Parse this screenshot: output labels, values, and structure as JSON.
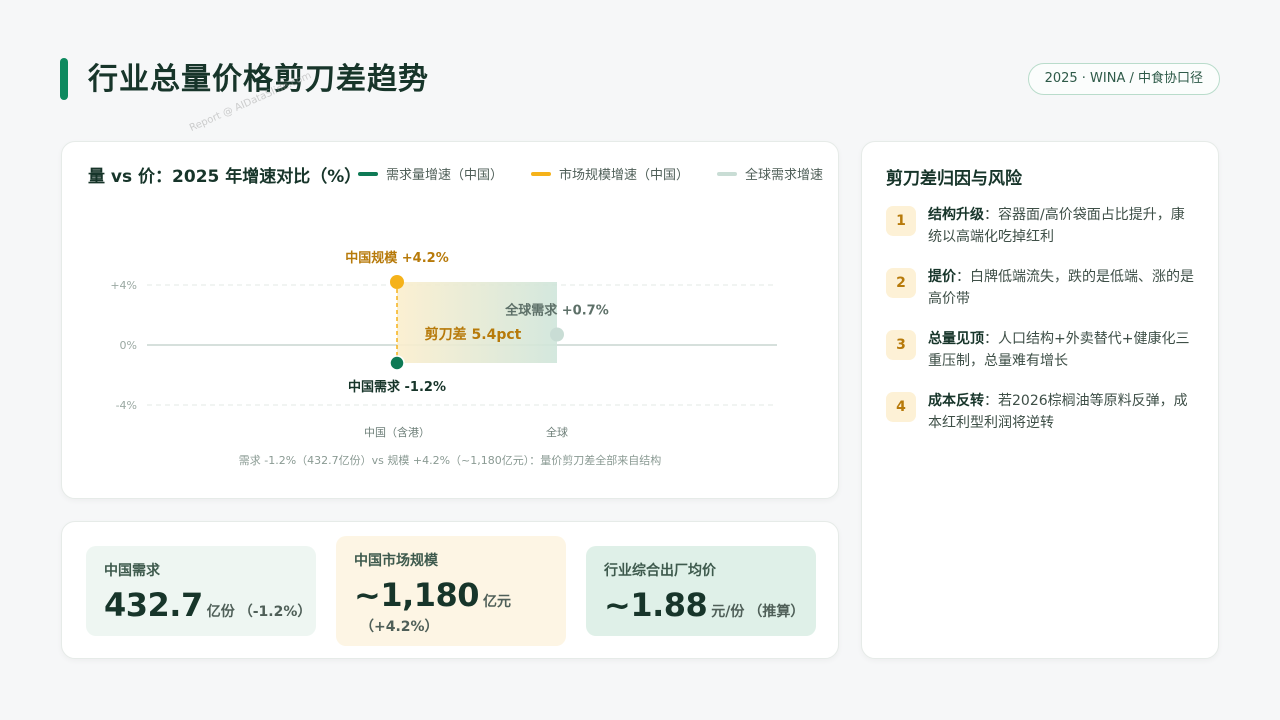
{
  "page": {
    "title": "行业总量价格剪刀差趋势",
    "source_badge": "2025 · WINA / 中食协口径",
    "watermark": "Report @ AIDataSlide.com"
  },
  "colors": {
    "accent": "#0e8a5f",
    "demand": "#0e7a55",
    "market": "#f5b21a",
    "global": "#c9ddd5",
    "scissor_text": "#b77a0a"
  },
  "chart_data": {
    "type": "scatter",
    "title": "量 vs 价：2025 年增速对比（%）",
    "legend": [
      {
        "name": "需求量增速（中国）",
        "color": "#0e7a55"
      },
      {
        "name": "市场规模增速（中国）",
        "color": "#f5b21a"
      },
      {
        "name": "全球需求增速",
        "color": "#c9ddd5"
      }
    ],
    "categories": [
      "中国（含港）",
      "全球"
    ],
    "yticks": [
      "+4%",
      "0%",
      "-4%"
    ],
    "ylim": [
      -4,
      4
    ],
    "series": [
      {
        "name": "需求量增速（中国）",
        "category": "中国（含港）",
        "value": -1.2,
        "label": "中国需求 -1.2%"
      },
      {
        "name": "市场规模增速（中国）",
        "category": "中国（含港）",
        "value": 4.2,
        "label": "中国规模 +4.2%"
      },
      {
        "name": "全球需求增速",
        "category": "全球",
        "value": 0.7,
        "label": "全球需求 +0.7%"
      }
    ],
    "annotation": "剪刀差 5.4pct",
    "footnote": "需求 -1.2%（432.7亿份）vs 规模 +4.2%（~1,180亿元）：量价剪刀差全部来自结构"
  },
  "kpis": [
    {
      "label": "中国需求",
      "value": "432.7",
      "unit": "亿份",
      "sub": "（-1.2%）"
    },
    {
      "label": "中国市场规模",
      "value": "~1,180",
      "unit": "亿元",
      "sub": "（+4.2%）"
    },
    {
      "label": "行业综合出厂均价",
      "value": "~1.88",
      "unit": "元/份",
      "sub": "（推算）"
    }
  ],
  "risks": {
    "title": "剪刀差归因与风险",
    "items": [
      {
        "num": "1",
        "head": "结构升级",
        "body": "：容器面/高价袋面占比提升，康统以高端化吃掉红利"
      },
      {
        "num": "2",
        "head": "提价",
        "body": "：白牌低端流失，跌的是低端、涨的是高价带"
      },
      {
        "num": "3",
        "head": "总量见顶",
        "body": "：人口结构+外卖替代+健康化三重压制，总量难有增长"
      },
      {
        "num": "4",
        "head": "成本反转",
        "body": "：若2026棕榈油等原料反弹，成本红利型利润将逆转"
      }
    ]
  }
}
